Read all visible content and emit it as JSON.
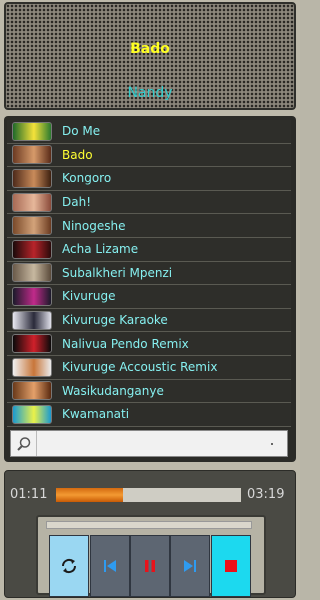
{
  "now_playing": {
    "title": "Bado",
    "artist": "Nandy"
  },
  "playlist": [
    {
      "label": "Do Me",
      "active": false
    },
    {
      "label": "Bado",
      "active": true
    },
    {
      "label": "Kongoro",
      "active": false
    },
    {
      "label": "Dah!",
      "active": false
    },
    {
      "label": "Ninogeshe",
      "active": false
    },
    {
      "label": "Acha Lizame",
      "active": false
    },
    {
      "label": "Subalkheri Mpenzi",
      "active": false
    },
    {
      "label": "Kivuruge",
      "active": false
    },
    {
      "label": "Kivuruge Karaoke",
      "active": false
    },
    {
      "label": "Nalivua Pendo Remix",
      "active": false
    },
    {
      "label": "Kivuruge Accoustic Remix",
      "active": false
    },
    {
      "label": "Wasikudanganye",
      "active": false
    },
    {
      "label": "Kwamanati",
      "active": false
    }
  ],
  "search": {
    "value": "",
    "placeholder": ""
  },
  "player": {
    "current_time": "01:11",
    "total_time": "03:19",
    "progress": 0.36
  },
  "colors": {
    "accent_title": "#ffff22",
    "accent_artist": "#33cccc",
    "progress": "#f39a32",
    "stop_button": "#1cd9ef"
  },
  "icons": {
    "search": "search-icon",
    "repeat": "repeat-icon",
    "previous": "skip-previous-icon",
    "pause": "pause-icon",
    "next": "skip-next-icon",
    "stop": "stop-icon"
  }
}
